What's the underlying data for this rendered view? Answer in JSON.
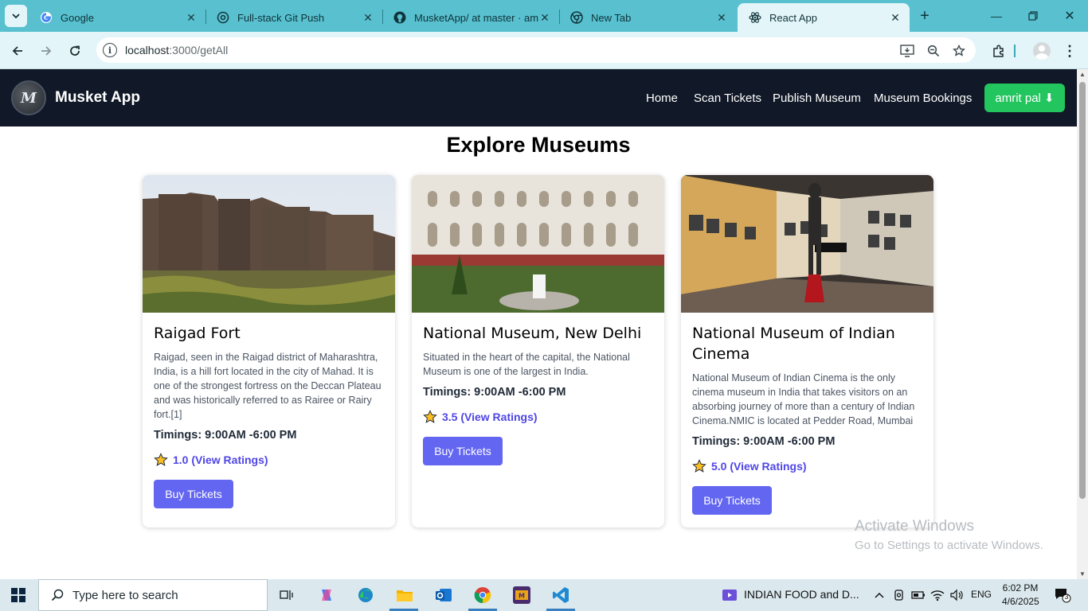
{
  "browser": {
    "tabs": [
      {
        "title": "Google",
        "icon": "google-icon"
      },
      {
        "title": "Full-stack Git Push",
        "icon": "openai-icon"
      },
      {
        "title": "MusketApp/ at master · amrit",
        "icon": "github-icon"
      },
      {
        "title": "New Tab",
        "icon": "chrome-icon"
      },
      {
        "title": "React App",
        "icon": "react-icon",
        "active": true
      }
    ],
    "url_host": "localhost",
    "url_path": ":3000/getAll"
  },
  "app": {
    "logo_text": "M",
    "brand": "Musket App",
    "nav": [
      "Home",
      "Scan Tickets",
      "Publish Museum",
      "Museum Bookings"
    ],
    "user_label": "amrit pal ⬇"
  },
  "page": {
    "title": "Explore Museums"
  },
  "museums": [
    {
      "name": "Raigad Fort",
      "description": "Raigad, seen in the Raigad district of Maharashtra, India, is a hill fort located in the city of Mahad. It is one of the strongest fortress on the Deccan Plateau and was historically referred to as Rairee or Rairy fort.[1]",
      "timings": "Timings: 9:00AM -6:00 PM",
      "rating": "1.0 (View Ratings)",
      "buy_label": "Buy Tickets"
    },
    {
      "name": "National Museum, New Delhi",
      "description": "Situated in the heart of the capital, the National Museum is one of the largest in India.",
      "timings": "Timings: 9:00AM -6:00 PM",
      "rating": "3.5 (View Ratings)",
      "buy_label": "Buy Tickets"
    },
    {
      "name": "National Museum of Indian Cinema",
      "description": "National Museum of Indian Cinema is the only cinema museum in India that takes visitors on an absorbing journey of more than a century of Indian Cinema.NMIC is located at Pedder Road, Mumbai",
      "timings": "Timings: 9:00AM -6:00 PM",
      "rating": "5.0 (View Ratings)",
      "buy_label": "Buy Tickets"
    }
  ],
  "watermark": {
    "line1": "Activate Windows",
    "line2": "Go to Settings to activate Windows."
  },
  "taskbar": {
    "search_placeholder": "Type here to search",
    "media_title": "INDIAN FOOD and D...",
    "language": "ENG",
    "time": "6:02 PM",
    "date": "4/6/2025",
    "notification_count": "3"
  },
  "colors": {
    "tab_strip": "#58c0cf",
    "navbar": "#111827",
    "user_button": "#22c55e",
    "buy_button": "#6366f1",
    "rating_link": "#4f46e5"
  }
}
